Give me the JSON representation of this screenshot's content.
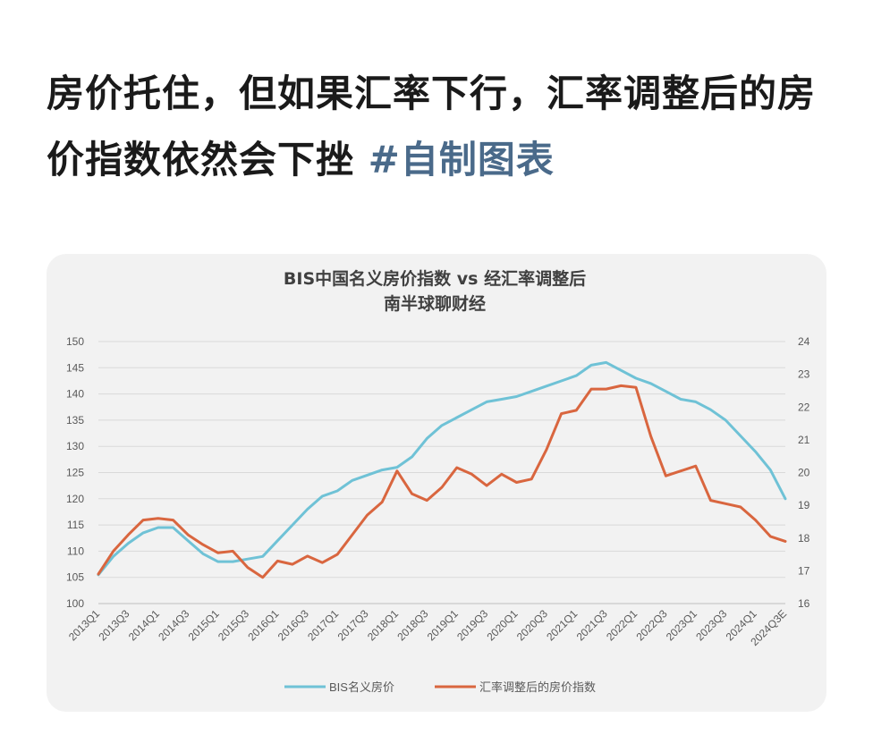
{
  "post": {
    "title": "房价托住，但如果汇率下行，汇率调整后的房价指数依然会下挫",
    "hashtag": "#自制图表"
  },
  "colors": {
    "series_blue": "#6fc2d6",
    "series_orange": "#d9663f",
    "card_bg": "#f2f2f2"
  },
  "chart_data": {
    "type": "line",
    "title": "BIS中国名义房价指数 vs 经汇率调整后",
    "subtitle": "南半球聊财经",
    "x": [
      "2013Q1",
      "2013Q2",
      "2013Q3",
      "2013Q4",
      "2014Q1",
      "2014Q2",
      "2014Q3",
      "2014Q4",
      "2015Q1",
      "2015Q2",
      "2015Q3",
      "2015Q4",
      "2016Q1",
      "2016Q2",
      "2016Q3",
      "2016Q4",
      "2017Q1",
      "2017Q2",
      "2017Q3",
      "2017Q4",
      "2018Q1",
      "2018Q2",
      "2018Q3",
      "2018Q4",
      "2019Q1",
      "2019Q2",
      "2019Q3",
      "2019Q4",
      "2020Q1",
      "2020Q2",
      "2020Q3",
      "2020Q4",
      "2021Q1",
      "2021Q2",
      "2021Q3",
      "2021Q4",
      "2022Q1",
      "2022Q2",
      "2022Q3",
      "2022Q4",
      "2023Q1",
      "2023Q2",
      "2023Q3",
      "2023Q4",
      "2024Q1",
      "2024Q2",
      "2024Q3E"
    ],
    "x_tick_labels": [
      "2013Q1",
      "2013Q3",
      "2014Q1",
      "2014Q3",
      "2015Q1",
      "2015Q3",
      "2016Q1",
      "2016Q3",
      "2017Q1",
      "2017Q3",
      "2018Q1",
      "2018Q3",
      "2019Q1",
      "2019Q3",
      "2020Q1",
      "2020Q3",
      "2021Q1",
      "2021Q3",
      "2022Q1",
      "2022Q3",
      "2023Q1",
      "2023Q3",
      "2024Q1",
      "2024Q3E"
    ],
    "y_left": {
      "ylim": [
        100,
        150
      ],
      "ticks": [
        100,
        105,
        110,
        115,
        120,
        125,
        130,
        135,
        140,
        145,
        150
      ]
    },
    "y_right": {
      "ylim": [
        16,
        24
      ],
      "ticks": [
        16,
        17,
        18,
        19,
        20,
        21,
        22,
        23,
        24
      ]
    },
    "grid": true,
    "legend": "bottom",
    "series": [
      {
        "name": "BIS名义房价",
        "axis": "left",
        "values": [
          105.5,
          109,
          111.5,
          113.5,
          114.5,
          114.5,
          112,
          109.5,
          108,
          108,
          108.5,
          109,
          112,
          115,
          118,
          120.5,
          121.5,
          123.5,
          124.5,
          125.5,
          126,
          128,
          131.5,
          134,
          135.5,
          137,
          138.5,
          139,
          139.5,
          140.5,
          141.5,
          142.5,
          143.5,
          145.5,
          146,
          144.5,
          143,
          142,
          140.5,
          139,
          138.5,
          137,
          135,
          132,
          129,
          125.5,
          120
        ]
      },
      {
        "name": "汇率调整后的房价指数",
        "axis": "right",
        "values": [
          16.9,
          17.6,
          18.1,
          18.55,
          18.6,
          18.55,
          18.1,
          17.8,
          17.55,
          17.6,
          17.1,
          16.8,
          17.3,
          17.2,
          17.45,
          17.25,
          17.5,
          18.1,
          18.7,
          19.1,
          20.05,
          19.35,
          19.15,
          19.55,
          20.15,
          19.95,
          19.6,
          19.95,
          19.7,
          19.8,
          20.7,
          21.8,
          21.9,
          22.55,
          22.55,
          22.65,
          22.6,
          21.1,
          19.9,
          20.05,
          20.2,
          19.15,
          19.05,
          18.95,
          18.55,
          18.05,
          17.9
        ]
      }
    ]
  }
}
